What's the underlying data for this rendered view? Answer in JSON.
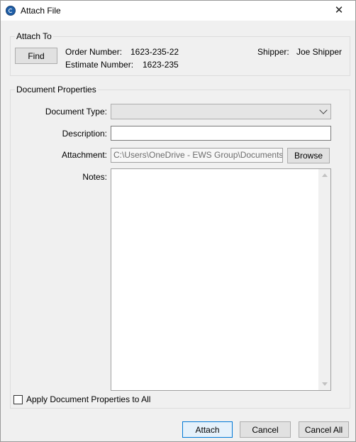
{
  "window": {
    "title": "Attach File",
    "close_symbol": "✕"
  },
  "attach_to": {
    "legend": "Attach To",
    "find_label": "Find",
    "order_number_label": "Order Number:",
    "order_number_value": "1623-235-22",
    "estimate_number_label": "Estimate Number:",
    "estimate_number_value": "1623-235",
    "shipper_label": "Shipper:",
    "shipper_value": "Joe Shipper"
  },
  "document_properties": {
    "legend": "Document Properties",
    "document_type_label": "Document Type:",
    "document_type_value": "",
    "description_label": "Description:",
    "description_value": "",
    "attachment_label": "Attachment:",
    "attachment_value": "C:\\Users\\OneDrive - EWS Group\\Documents",
    "browse_label": "Browse",
    "notes_label": "Notes:",
    "notes_value": "",
    "apply_all_label": "Apply Document Properties to All",
    "apply_all_checked": false
  },
  "footer": {
    "attach_label": "Attach",
    "cancel_label": "Cancel",
    "cancel_all_label": "Cancel All"
  },
  "icons": {
    "app": "app-logo-icon",
    "close": "close-icon",
    "dropdown": "chevron-down-icon",
    "scroll_up": "scroll-up-arrow-icon",
    "scroll_down": "scroll-down-arrow-icon"
  },
  "colors": {
    "window_bg": "#f0f0f0",
    "titlebar_bg": "#ffffff",
    "primary_button_border": "#0078d7",
    "primary_button_bg": "#e5f1fb"
  }
}
